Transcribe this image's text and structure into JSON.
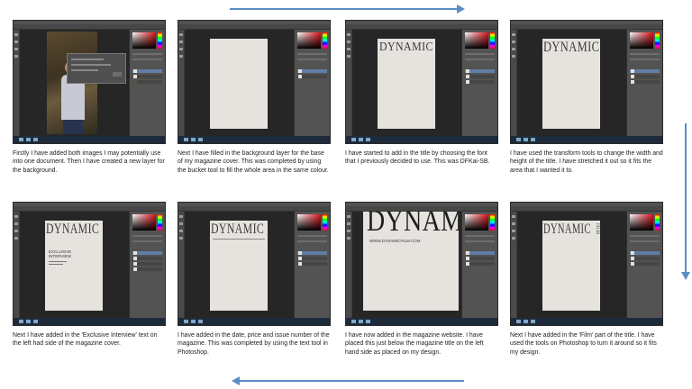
{
  "dynamic_title": "DYNAMIC",
  "steps": [
    {
      "caption": "Firstly I have added both images I may potentially use into one document. Then I have created a new layer for the background."
    },
    {
      "caption": "Next I have filled in the background layer for the base of my magazine cover. This was completed by using the bucket tool to fill the whole area in the same colour."
    },
    {
      "caption": "I have started to add in the title by choosing the font that I previously decided to use. This was DFKai-SB."
    },
    {
      "caption": "I have used the transform tools to change the width and height of the title. I have stretched it out so it fits the area that I wanted it to."
    },
    {
      "caption": "Next I have added in the 'Exclusive Interview' text on the left had side of the magazine cover.",
      "cover_text": "EXCLUSIVE\nINTERVIEW"
    },
    {
      "caption": "I have added in the date, price and issue number of the magazine. This was completed by using the text tool in Photoshop."
    },
    {
      "caption": "I have now added in the magazine website. I have placed this just below the magazine title on the left hand side as placed on my design.",
      "big_title": "DYNAM",
      "website": "WWW.DYNAMICFILM.COM"
    },
    {
      "caption": "Next I have added in the 'Film' part of the title. I have used the tools on Photoshop to turn it around so it fits my design.",
      "film_text": "FILM"
    }
  ],
  "colors": {
    "arrow": "#5b8ec4",
    "cover_bg": "#e6e2de"
  }
}
